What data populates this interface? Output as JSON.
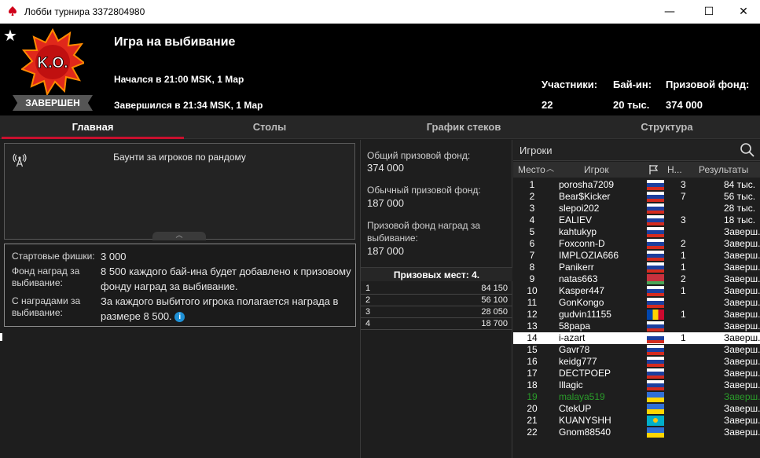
{
  "window": {
    "title": "Лобби турнира 3372804980",
    "minimize": "—",
    "maximize": "☐",
    "close": "✕"
  },
  "header": {
    "logo_text": "K.O.",
    "status_badge": "ЗАВЕРШЕН",
    "game_name": "Игра на выбивание",
    "started": "Начался в 21:00 MSK, 1 Мар",
    "ended": "Завершился в 21:34 MSK, 1 Мар",
    "stats": [
      {
        "label": "Участники:",
        "value": "22"
      },
      {
        "label": "Бай-ин:",
        "value": "20 тыс."
      },
      {
        "label": "Призовой фонд:",
        "value": "374 000"
      }
    ]
  },
  "tabs": [
    {
      "label": "Главная",
      "active": true
    },
    {
      "label": "Столы",
      "active": false
    },
    {
      "label": "График стеков",
      "active": false
    },
    {
      "label": "Структура",
      "active": false
    }
  ],
  "bounty": {
    "title": "Баунти за игроков по рандому",
    "collapse_glyph": "︿"
  },
  "info": {
    "rows": [
      {
        "label": "Стартовые фишки:",
        "value": "3 000"
      },
      {
        "label": "Фонд наград за выбивание:",
        "value": "8 500 каждого бай-ина будет добавлено к призовому фонду наград за выбивание."
      },
      {
        "label": "С наградами за выбивание:",
        "value": "За каждого выбитого игрока полагается награда в размере 8 500."
      }
    ],
    "info_icon": "i"
  },
  "prizes": {
    "total_label": "Общий призовой фонд:",
    "total_value": "374 000",
    "regular_label": "Обычный призовой фонд:",
    "regular_value": "187 000",
    "bounty_label": "Призовой фонд наград за выбивание:",
    "bounty_value": "187 000",
    "places_title": "Призовых мест: 4.",
    "places": [
      {
        "place": "1",
        "amount": "84 150"
      },
      {
        "place": "2",
        "amount": "56 100"
      },
      {
        "place": "3",
        "amount": "28 050"
      },
      {
        "place": "4",
        "amount": "18 700"
      }
    ]
  },
  "players": {
    "search_label": "Игроки",
    "columns": {
      "place": "Место",
      "sort_glyph": "︿",
      "player": "Игрок",
      "ko": "Н...",
      "results": "Результаты"
    },
    "colors": {
      "highlight": "#ffffff",
      "green": "#2a9d2a"
    },
    "rows": [
      {
        "place": "1",
        "name": "porosha7209",
        "flag": "ru",
        "ko": "3",
        "result": "84 тыс."
      },
      {
        "place": "2",
        "name": "Bear$Kicker",
        "flag": "ru",
        "ko": "7",
        "result": "56 тыс."
      },
      {
        "place": "3",
        "name": "slepoi202",
        "flag": "ru",
        "ko": "",
        "result": "28 тыс."
      },
      {
        "place": "4",
        "name": "EALIEV",
        "flag": "ru",
        "ko": "3",
        "result": "18 тыс."
      },
      {
        "place": "5",
        "name": "kahtukyp",
        "flag": "ru",
        "ko": "",
        "result": "Заверш..."
      },
      {
        "place": "6",
        "name": "Foxconn-D",
        "flag": "ru",
        "ko": "2",
        "result": "Заверш..."
      },
      {
        "place": "7",
        "name": "IMPLOZIA666",
        "flag": "ru",
        "ko": "1",
        "result": "Заверш..."
      },
      {
        "place": "8",
        "name": "Panikerr",
        "flag": "ru",
        "ko": "1",
        "result": "Заверш..."
      },
      {
        "place": "9",
        "name": "natas663",
        "flag": "by",
        "ko": "2",
        "result": "Заверш..."
      },
      {
        "place": "10",
        "name": "Kasper447",
        "flag": "ru",
        "ko": "1",
        "result": "Заверш..."
      },
      {
        "place": "11",
        "name": "GonKongo",
        "flag": "ru",
        "ko": "",
        "result": "Заверш..."
      },
      {
        "place": "12",
        "name": "gudvin11155",
        "flag": "md",
        "ko": "1",
        "result": "Заверш..."
      },
      {
        "place": "13",
        "name": "58papa",
        "flag": "ru",
        "ko": "",
        "result": "Заверш..."
      },
      {
        "place": "14",
        "name": "i-azart",
        "flag": "ru",
        "ko": "1",
        "result": "Заверш...",
        "highlight": true
      },
      {
        "place": "15",
        "name": "Gavr78",
        "flag": "ru",
        "ko": "",
        "result": "Заверш..."
      },
      {
        "place": "16",
        "name": "keidg777",
        "flag": "ru",
        "ko": "",
        "result": "Заверш..."
      },
      {
        "place": "17",
        "name": "DECTPOEP",
        "flag": "ru",
        "ko": "",
        "result": "Заверш..."
      },
      {
        "place": "18",
        "name": "Illagic",
        "flag": "ru",
        "ko": "",
        "result": "Заверш..."
      },
      {
        "place": "19",
        "name": "malaya519",
        "flag": "ua",
        "ko": "",
        "result": "Заверш...",
        "green": true
      },
      {
        "place": "20",
        "name": "CtekUP",
        "flag": "ua",
        "ko": "",
        "result": "Заверш..."
      },
      {
        "place": "21",
        "name": "KUANYSHH",
        "flag": "kz",
        "ko": "",
        "result": "Заверш..."
      },
      {
        "place": "22",
        "name": "Gnom88540",
        "flag": "ua",
        "ko": "",
        "result": "Заверш..."
      }
    ]
  }
}
